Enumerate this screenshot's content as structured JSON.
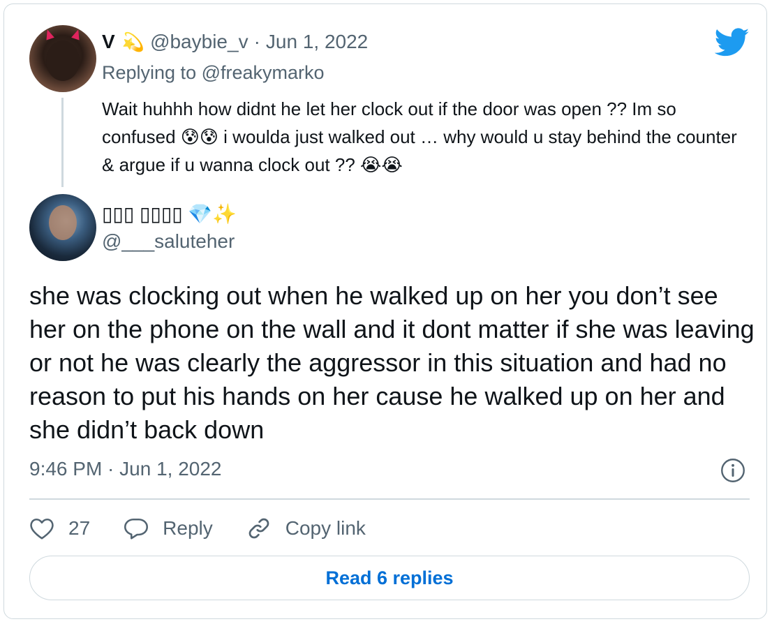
{
  "colors": {
    "twitter_blue": "#1d9bf0",
    "link_blue": "#006fd6",
    "text_primary": "#0f1419",
    "text_secondary": "#536471",
    "border": "#cfd9de"
  },
  "parent_tweet": {
    "display_name": "V",
    "name_emoji": "💫",
    "handle": "@baybie_v",
    "separator": "·",
    "date": "Jun 1, 2022",
    "replying_prefix": "Replying to",
    "replying_to": "@freakymarko",
    "text": "Wait huhhh how didnt he let her clock out if the door was open ?? Im so confused 😰😰 i woulda just walked out … why would u stay behind the counter & argue if u wanna clock out ?? 😭😭"
  },
  "main_tweet": {
    "display_name": "▯▯▯ ▯▯▯▯ 💎✨",
    "handle": "@___saluteher",
    "text": "she was clocking out when he walked up on her you don’t see her on the phone on the wall and it dont matter if she was leaving or not he was clearly the aggressor in this situation  and had no reason to put his hands on her cause he walked up on her and she didn’t back down",
    "timestamp": "9:46 PM · Jun 1, 2022"
  },
  "actions": {
    "like_icon": "heart-icon",
    "like_count": "27",
    "reply_icon": "speech-bubble-icon",
    "reply_label": "Reply",
    "copy_icon": "link-icon",
    "copy_label": "Copy link"
  },
  "footer": {
    "read_replies_label": "Read 6 replies"
  },
  "icons": {
    "brand": "twitter-bird-icon",
    "info": "info-icon"
  }
}
